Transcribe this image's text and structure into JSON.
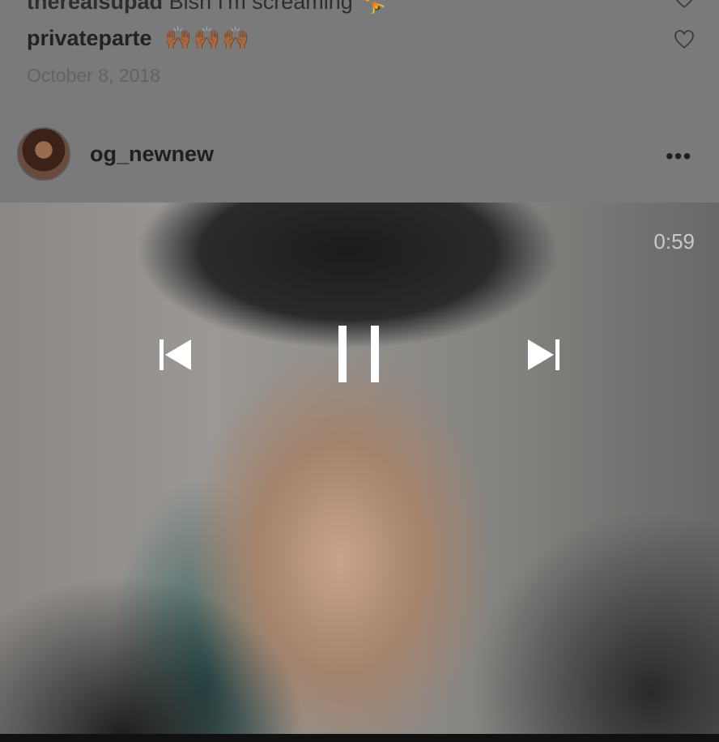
{
  "comments": [
    {
      "user": "therealsupad",
      "text": "Bish I'm screaming 🤸"
    },
    {
      "user": "privateparte",
      "text": "🙌🏾🙌🏾🙌🏾"
    }
  ],
  "date": "October 8, 2018",
  "post": {
    "username": "og_newnew",
    "more_label": "•••"
  },
  "video": {
    "time_remaining": "0:59",
    "state": "playing"
  },
  "icons": {
    "like": "heart-icon",
    "previous": "skip-previous-icon",
    "pause": "pause-icon",
    "next": "skip-next-icon",
    "more": "more-options-icon"
  },
  "colors": {
    "overlay": "#7a7a7a",
    "control": "#ffffff"
  }
}
